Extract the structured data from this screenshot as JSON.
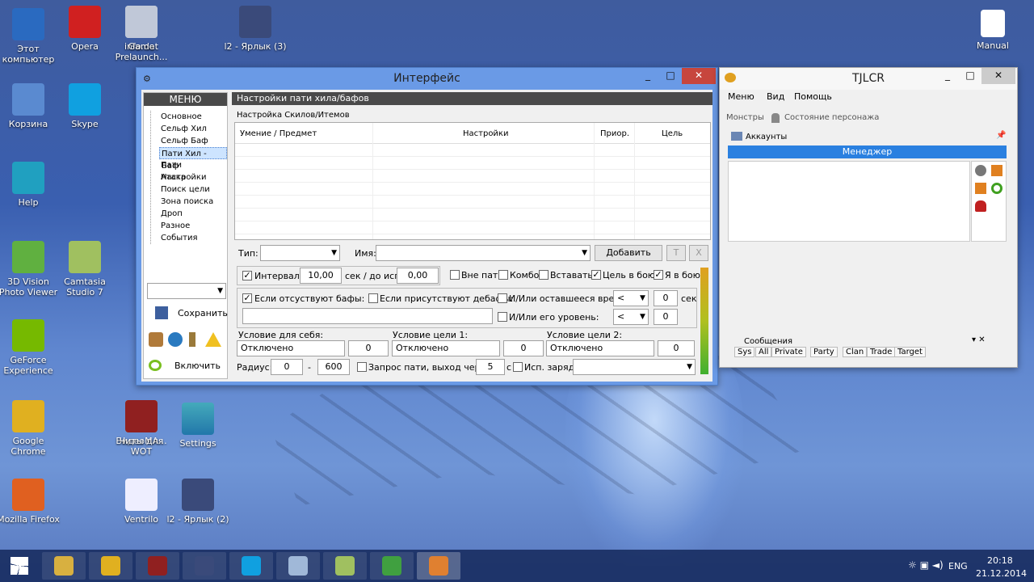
{
  "desktop": {
    "icons_left": [
      {
        "label": "Этот компьютер",
        "icon": "computer-icon"
      },
      {
        "label": "Корзина",
        "icon": "recycle-bin-icon"
      },
      {
        "label": "Help",
        "icon": "help-icon"
      },
      {
        "label": "3D Vision Photo Viewer",
        "icon": "3dvision-icon"
      },
      {
        "label": "GeForce Experience",
        "icon": "geforce-icon"
      },
      {
        "label": "Google Chrome",
        "icon": "chrome-icon"
      },
      {
        "label": "Mozilla Firefox",
        "icon": "firefox-icon"
      }
    ],
    "icons_col2": [
      {
        "label": "Opera",
        "icon": "opera-icon"
      },
      {
        "label": "Skype",
        "icon": "skype-icon"
      },
      {
        "label": "Camtasia Studio 7",
        "icon": "camtasia-icon"
      },
      {
        "label": "ВидеоМА...",
        "icon": "video-icon"
      },
      {
        "label": "l2 - Ярлык (2)",
        "icon": "l2-icon"
      }
    ],
    "icons_top": [
      {
        "label": "l2 - Ярлык (3)",
        "icon": "l2-icon"
      },
      {
        "label": "info.dat",
        "icon": "file-icon"
      },
      {
        "label": "Game Prelaunch...",
        "icon": "folder-icon"
      }
    ],
    "icons_col3": [
      {
        "label": "Читы для WOT",
        "icon": "wot-icon"
      },
      {
        "label": "Ventrilo",
        "icon": "ventrilo-icon"
      }
    ],
    "settings_label": "Settings",
    "partial_labels": [
      "Mo",
      "Bro",
      "St",
      "Пр",
      "C",
      "B",
      "Я",
      "Ч"
    ],
    "manual_label": "Manual"
  },
  "iface": {
    "title": "Интерфейс",
    "menu_header": "МЕНЮ",
    "menu_items": [
      "Основное",
      "Сельф Хил",
      "Сельф Баф",
      "Пати Хил - Баф",
      "Пати Настройки",
      "Атака",
      "Поиск цели",
      "Зона поиска",
      "Дроп",
      "Разное",
      "События"
    ],
    "selected_index": 3,
    "save_label": "Сохранить",
    "enable_label": "Включить",
    "panel_header": "Настройки пати хила/бафов",
    "group_label": "Настройка Скилов/Итемов",
    "columns": [
      "Умение / Предмет",
      "Настройки",
      "Приор.",
      "Цель"
    ],
    "type_label": "Тип:",
    "name_label": "Имя:",
    "add_label": "Добавить",
    "t_label": "T",
    "x_label": "X",
    "interval_label": "Интервал:",
    "interval_value": "10,00",
    "sec_label": "сек / до исп:",
    "before_value": "0,00",
    "no_party_label": "Вне пати",
    "combo_label": "Комбо",
    "insert_label": "Вставать",
    "target_fight_label": "Цель в бою",
    "me_fight_label": "Я в бою",
    "no_buffs_label": "Если отсуствуют бафы:",
    "debuffs_label": "Если присутствуют дебафы:",
    "time_left_label": "И/Или оставшееся время:",
    "lt": "<",
    "zero": "0",
    "sec": "сек",
    "level_label": "И/Или его уровень:",
    "self_cond_label": "Условие для себя:",
    "target1_label": "Условие цели 1:",
    "target2_label": "Условие цели 2:",
    "disabled": "Отключено",
    "radius_label": "Радиус:",
    "radius_from": "0",
    "dash": "-",
    "radius_to": "600",
    "party_req_label": "Запрос пати, выход через:",
    "party_req_value": "5",
    "c_label": "с",
    "use_charge_label": "Исп. заряд:"
  },
  "tjlcr": {
    "title": "TJLCR",
    "menu": [
      "Меню",
      "Вид",
      "Помощь"
    ],
    "monsters": "Монстры",
    "char_state": "Состояние персонажа",
    "accounts": "Аккаунты",
    "manager": "Менеджер",
    "messages": "Сообщения",
    "tabs": [
      "Sys",
      "All",
      "Private",
      "Party",
      "Clan",
      "Trade",
      "Target"
    ]
  },
  "taskbar": {
    "lang": "ENG",
    "time": "20:18",
    "date": "21.12.2014"
  }
}
